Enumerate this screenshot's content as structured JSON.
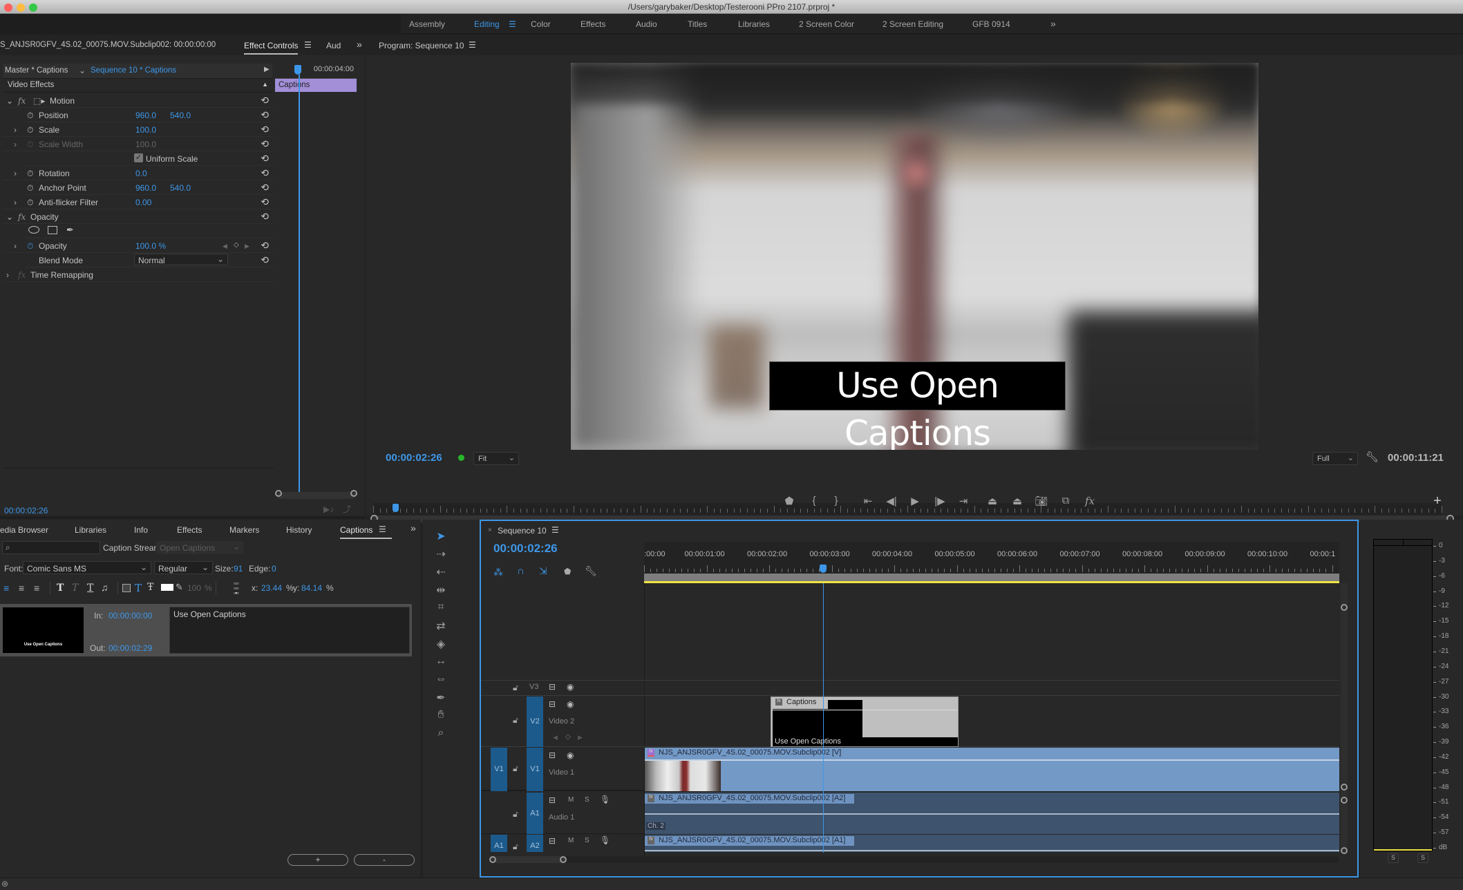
{
  "window": {
    "title": "/Users/garybaker/Desktop/Testerooni PPro 2107.prproj *"
  },
  "workspaces": {
    "items": [
      {
        "label": "Assembly",
        "active": false
      },
      {
        "label": "Editing",
        "active": true
      },
      {
        "label": "Color",
        "active": false
      },
      {
        "label": "Effects",
        "active": false
      },
      {
        "label": "Audio",
        "active": false
      },
      {
        "label": "Titles",
        "active": false
      },
      {
        "label": "Libraries",
        "active": false
      },
      {
        "label": "2 Screen Color",
        "active": false
      },
      {
        "label": "2 Screen Editing",
        "active": false
      },
      {
        "label": "GFB 0914",
        "active": false
      }
    ],
    "overflow": "»"
  },
  "source_panel": {
    "clip_label": "S_ANJSR0GFV_4S.02_00075.MOV.Subclip002: 00:00:00:00",
    "tabs": [
      "Effect Controls",
      "Aud"
    ],
    "overflow": "»"
  },
  "effect_controls": {
    "master_label": "Master * Captions",
    "sequence_label": "Sequence 10 * Captions",
    "ruler_time": "00:00:04:00",
    "clip_bar_label": "Captions",
    "section_label": "Video Effects",
    "motion": {
      "label": "Motion",
      "position": {
        "label": "Position",
        "x": "960.0",
        "y": "540.0"
      },
      "scale": {
        "label": "Scale",
        "value": "100.0"
      },
      "scale_width": {
        "label": "Scale Width",
        "value": "100.0"
      },
      "uniform_scale": {
        "label": "Uniform Scale",
        "checked": true
      },
      "rotation": {
        "label": "Rotation",
        "value": "0.0"
      },
      "anchor_point": {
        "label": "Anchor Point",
        "x": "960.0",
        "y": "540.0"
      },
      "anti_flicker": {
        "label": "Anti-flicker Filter",
        "value": "0.00"
      }
    },
    "opacity": {
      "label": "Opacity",
      "opacity": {
        "label": "Opacity",
        "value": "100.0 %"
      },
      "blend_mode": {
        "label": "Blend Mode",
        "value": "Normal"
      }
    },
    "time_remapping": {
      "label": "Time Remapping"
    },
    "current_time": "00:00:02:26"
  },
  "program_monitor": {
    "title": "Program: Sequence 10",
    "caption_text": "Use Open Captions",
    "timecode": "00:00:02:26",
    "zoom": "Fit",
    "resolution": "Full",
    "duration": "00:00:11:21",
    "playhead_fraction": 0.25
  },
  "bottom_left_panel": {
    "tabs": [
      "edia Browser",
      "Libraries",
      "Info",
      "Effects",
      "Markers",
      "History",
      "Captions"
    ],
    "active_tab": "Captions",
    "overflow": "»",
    "search_placeholder": "",
    "caption_stream_label": "Caption Stream:",
    "caption_stream_value": "Open Captions",
    "font_label": "Font:",
    "font_value": "Comic Sans MS",
    "style_value": "Regular",
    "size_label": "Size:",
    "size_value": "91",
    "edge_label": "Edge:",
    "edge_value": "0",
    "opacity_value": "100",
    "opacity_unit": "%",
    "x_label": "x:",
    "x_value": "23.44",
    "y_label": "y:",
    "y_value": "84.14",
    "pct": "%",
    "caption": {
      "thumb_text": "Use Open Captions",
      "in_label": "In:",
      "in_value": "00:00:00:00",
      "out_label": "Out:",
      "out_value": "00:00:02:29",
      "text": "Use Open Captions"
    },
    "add_label": "+",
    "remove_label": "-"
  },
  "timeline": {
    "tab_label": "Sequence 10",
    "timecode": "00:00:02:26",
    "ruler_labels": [
      ":00:00",
      "00:00:01:00",
      "00:00:02:00",
      "00:00:03:00",
      "00:00:04:00",
      "00:00:05:00",
      "00:00:06:00",
      "00:00:07:00",
      "00:00:08:00",
      "00:00:09:00",
      "00:00:10:00",
      "00:00:1"
    ],
    "tracks": {
      "v3": {
        "label": "V3"
      },
      "v2": {
        "label": "V2",
        "name": "Video 2"
      },
      "v1": {
        "source": "V1",
        "label": "V1",
        "name": "Video 1"
      },
      "a1": {
        "label": "A1",
        "name": "Audio 1",
        "m": "M",
        "s": "S"
      },
      "a2": {
        "source": "A1",
        "label": "A2",
        "m": "M",
        "s": "S"
      }
    },
    "clips": {
      "captions": {
        "title": "Captions",
        "text": "Use Open Captions"
      },
      "video": {
        "title": "NJS_ANJSR0GFV_4S.02_00075.MOV.Subclip002 [V]"
      },
      "audio_a2": {
        "title": "NJS_ANJSR0GFV_4S.02_00075.MOV.Subclip002 [A2]",
        "channel": "Ch. 2"
      },
      "audio_a1": {
        "title": "NJS_ANJSR0GFV_4S.02_00075.MOV.Subclip002 [A1]"
      }
    }
  },
  "audio_meter": {
    "scale": [
      "0",
      "-3",
      "-6",
      "-9",
      "-12",
      "-15",
      "-18",
      "-21",
      "-24",
      "-27",
      "-30",
      "-33",
      "-36",
      "-39",
      "-42",
      "-45",
      "-48",
      "-51",
      "-54",
      "-57",
      "dB"
    ],
    "solo_labels": [
      "S",
      "S"
    ]
  },
  "colors": {
    "accent": "#3d97e8",
    "caption_clip": "#a28fd8",
    "video_clip": "#7399c6",
    "audio_clip": "#3e536d",
    "work_area": "#f0e442"
  }
}
